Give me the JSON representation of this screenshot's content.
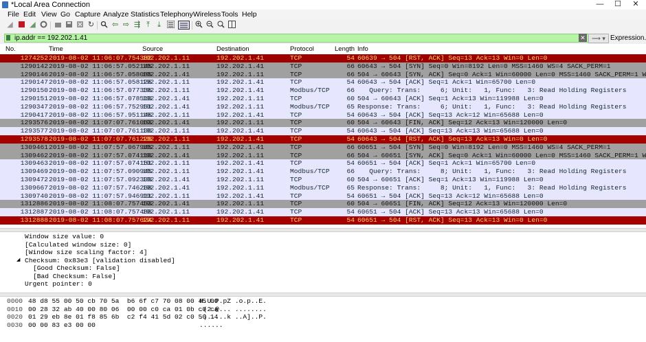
{
  "window": {
    "title": "*Local Area Connection",
    "controls": {
      "minimize": "—",
      "maximize": "☐",
      "close": "✕"
    }
  },
  "menu": [
    "File",
    "Edit",
    "View",
    "Go",
    "Capture",
    "Analyze",
    "Statistics",
    "Telephony",
    "Wireless",
    "Tools",
    "Help"
  ],
  "toolbar_icons": [
    "shark-fin-start-icon",
    "stop-icon",
    "restart-icon",
    "gear-options-icon",
    "open-file-icon",
    "save-file-icon",
    "close-file-icon",
    "reload-icon",
    "find-packet-icon",
    "go-back-icon",
    "go-forward-icon",
    "go-to-packet-icon",
    "go-first-icon",
    "go-last-icon",
    "auto-scroll-icon",
    "colorize-icon",
    "zoom-in-icon",
    "zoom-out-icon",
    "zoom-normal-icon",
    "resize-columns-icon"
  ],
  "filter": {
    "value": "ip.addr == 192.202.1.41",
    "clear": "✕",
    "apply": "⟶ ▾",
    "expression_label": "Expression..."
  },
  "columns": {
    "no": "No.",
    "time": "Time",
    "source": "Source",
    "destination": "Destination",
    "protocol": "Protocol",
    "length": "Length",
    "info": "Info"
  },
  "packets": [
    {
      "no": "1274252",
      "time": "2019-08-02 11:06:07.754382",
      "src": "192.202.1.11",
      "dst": "192.202.1.41",
      "proto": "TCP",
      "len": "54",
      "info": "60639 → 504 [RST, ACK] Seq=13 Ack=13 Win=0 Len=0",
      "style": "sel"
    },
    {
      "no": "1290142",
      "time": "2019-08-02 11:06:57.052145",
      "src": "192.202.1.11",
      "dst": "192.202.1.41",
      "proto": "TCP",
      "len": "66",
      "info": "60643 → 504 [SYN] Seq=0 Win=8192 Len=0 MSS=1460 WS=4 SACK_PERM=1",
      "style": "gray"
    },
    {
      "no": "1290146",
      "time": "2019-08-02 11:06:57.058085",
      "src": "192.202.1.41",
      "dst": "192.202.1.11",
      "proto": "TCP",
      "len": "66",
      "info": "504 → 60643 [SYN, ACK] Seq=0 Ack=1 Win=60000 Len=0 MSS=1460 SACK_PERM=1 WS=2",
      "style": "gray"
    },
    {
      "no": "1290147",
      "time": "2019-08-02 11:06:57.058126",
      "src": "192.202.1.11",
      "dst": "192.202.1.41",
      "proto": "TCP",
      "len": "54",
      "info": "60643 → 504 [ACK] Seq=1 Ack=1 Win=65700 Len=0",
      "style": "tcp"
    },
    {
      "no": "1290150",
      "time": "2019-08-02 11:06:57.077336",
      "src": "192.202.1.11",
      "dst": "192.202.1.41",
      "proto": "Modbus/TCP",
      "len": "66",
      "info": "   Query: Trans:     6; Unit:   1, Func:   3: Read Holding Registers",
      "style": "tcp"
    },
    {
      "no": "1290151",
      "time": "2019-08-02 11:06:57.078510",
      "src": "192.202.1.41",
      "dst": "192.202.1.11",
      "proto": "TCP",
      "len": "60",
      "info": "504 → 60643 [ACK] Seq=1 Ack=13 Win=119988 Len=0",
      "style": "tcp"
    },
    {
      "no": "1290347",
      "time": "2019-08-02 11:06:57.752951",
      "src": "192.202.1.41",
      "dst": "192.202.1.11",
      "proto": "Modbus/TCP",
      "len": "65",
      "info": "Response: Trans:     6; Unit:   1, Func:   3: Read Holding Registers",
      "style": "tcp"
    },
    {
      "no": "1290417",
      "time": "2019-08-02 11:06:57.951146",
      "src": "192.202.1.11",
      "dst": "192.202.1.41",
      "proto": "TCP",
      "len": "54",
      "info": "60643 → 504 [ACK] Seq=13 Ack=12 Win=65688 Len=0",
      "style": "tcp"
    },
    {
      "no": "1293576",
      "time": "2019-08-02 11:07:07.761063",
      "src": "192.202.1.41",
      "dst": "192.202.1.11",
      "proto": "TCP",
      "len": "60",
      "info": "504 → 60643 [FIN, ACK] Seq=12 Ack=13 Win=120000 Len=0",
      "style": "gray"
    },
    {
      "no": "1293577",
      "time": "2019-08-02 11:07:07.761100",
      "src": "192.202.1.11",
      "dst": "192.202.1.41",
      "proto": "TCP",
      "len": "54",
      "info": "60643 → 504 [ACK] Seq=13 Ack=13 Win=65688 Len=0",
      "style": "tcp"
    },
    {
      "no": "1293578",
      "time": "2019-08-02 11:07:07.761229",
      "src": "192.202.1.11",
      "dst": "192.202.1.41",
      "proto": "TCP",
      "len": "54",
      "info": "60643 → 504 [RST, ACK] Seq=13 Ack=13 Win=0 Len=0",
      "style": "rst"
    },
    {
      "no": "1309461",
      "time": "2019-08-02 11:07:57.067945",
      "src": "192.202.1.11",
      "dst": "192.202.1.41",
      "proto": "TCP",
      "len": "66",
      "info": "60651 → 504 [SYN] Seq=0 Win=8192 Len=0 MSS=1460 WS=4 SACK_PERM=1",
      "style": "gray"
    },
    {
      "no": "1309462",
      "time": "2019-08-02 11:07:57.074110",
      "src": "192.202.1.41",
      "dst": "192.202.1.11",
      "proto": "TCP",
      "len": "66",
      "info": "504 → 60651 [SYN, ACK] Seq=0 Ack=1 Win=60000 Len=0 MSS=1460 SACK_PERM=1 WS=2",
      "style": "gray"
    },
    {
      "no": "1309463",
      "time": "2019-08-02 11:07:57.074151",
      "src": "192.202.1.11",
      "dst": "192.202.1.41",
      "proto": "TCP",
      "len": "54",
      "info": "60651 → 504 [ACK] Seq=1 Ack=1 Win=65700 Len=0",
      "style": "tcp"
    },
    {
      "no": "1309469",
      "time": "2019-08-02 11:07:57.090945",
      "src": "192.202.1.11",
      "dst": "192.202.1.41",
      "proto": "Modbus/TCP",
      "len": "66",
      "info": "   Query: Trans:     8; Unit:   1, Func:   3: Read Holding Registers",
      "style": "tcp"
    },
    {
      "no": "1309472",
      "time": "2019-08-02 11:07:57.092309",
      "src": "192.202.1.41",
      "dst": "192.202.1.11",
      "proto": "TCP",
      "len": "60",
      "info": "504 → 60651 [ACK] Seq=1 Ack=13 Win=119988 Len=0",
      "style": "tcp"
    },
    {
      "no": "1309667",
      "time": "2019-08-02 11:07:57.746268",
      "src": "192.202.1.41",
      "dst": "192.202.1.11",
      "proto": "Modbus/TCP",
      "len": "65",
      "info": "Response: Trans:     8; Unit:   1, Func:   3: Read Holding Registers",
      "style": "tcp"
    },
    {
      "no": "1309740",
      "time": "2019-08-02 11:07:57.946911",
      "src": "192.202.1.11",
      "dst": "192.202.1.41",
      "proto": "TCP",
      "len": "54",
      "info": "60651 → 504 [ACK] Seq=13 Ack=12 Win=65688 Len=0",
      "style": "tcp"
    },
    {
      "no": "1312886",
      "time": "2019-08-02 11:08:07.757453",
      "src": "192.202.1.41",
      "dst": "192.202.1.11",
      "proto": "TCP",
      "len": "60",
      "info": "504 → 60651 [FIN, ACK] Seq=12 Ack=13 Win=120000 Len=0",
      "style": "gray"
    },
    {
      "no": "1312887",
      "time": "2019-08-02 11:08:07.757488",
      "src": "192.202.1.11",
      "dst": "192.202.1.41",
      "proto": "TCP",
      "len": "54",
      "info": "60651 → 504 [ACK] Seq=13 Ack=13 Win=65688 Len=0",
      "style": "tcp"
    },
    {
      "no": "1312888",
      "time": "2019-08-02 11:08:07.757624",
      "src": "192.202.1.11",
      "dst": "192.202.1.41",
      "proto": "TCP",
      "len": "54",
      "info": "60651 → 504 [RST, ACK] Seq=13 Ack=13 Win=0 Len=0",
      "style": "rst"
    }
  ],
  "details": [
    {
      "text": "Window size value: 0",
      "indent": 0
    },
    {
      "text": "[Calculated window size: 0]",
      "indent": 0
    },
    {
      "text": "[Window size scaling factor: 4]",
      "indent": 0
    },
    {
      "text": "Checksum: 0x83e3 [validation disabled]",
      "indent": 0,
      "expanded": true
    },
    {
      "text": "[Good Checksum: False]",
      "indent": 1
    },
    {
      "text": "[Bad Checksum: False]",
      "indent": 1
    },
    {
      "text": "Urgent pointer: 0",
      "indent": 0
    }
  ],
  "bytes": [
    {
      "offset": "0000",
      "hex": "48 d8 55 00 50 cb 70 5a  b6 6f c7 70 08 00 45 00",
      "ascii": "H.U.P.pZ .o.p..E."
    },
    {
      "offset": "0010",
      "hex": "00 28 32 ab 40 00 80 06  00 00 c0 ca 01 0b c0 ca",
      "ascii": ".(2.@... ........"
    },
    {
      "offset": "0020",
      "hex": "01 29 eb 8e 01 f8 85 6b  c2 f4 41 5d 02 c0 50 14",
      "ascii": ".).....k ..A]..P."
    },
    {
      "offset": "0030",
      "hex": "00 00 83 e3 00 00",
      "ascii": "......"
    }
  ]
}
